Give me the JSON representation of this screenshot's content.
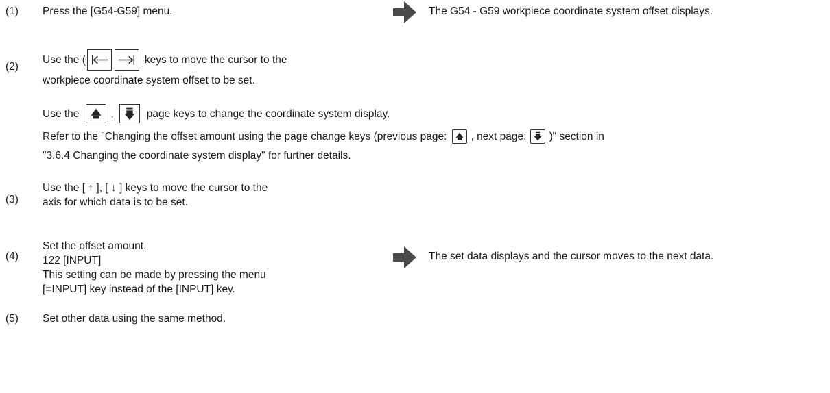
{
  "steps": [
    {
      "number": "(1)",
      "text": "Press the [G54-G59] menu.",
      "result": "The G54 - G59 workpiece coordinate system offset displays."
    },
    {
      "number": "(2)",
      "line1_prefix": "Use the (",
      "line1_suffix": "keys to move the cursor to the",
      "line2": "workpiece coordinate system offset to be set.",
      "page_keys_prefix": "Use the",
      "page_keys_comma": ",",
      "page_keys_suffix": "page keys to change the coordinate system display.",
      "refer_prefix": "Refer to the \"Changing the offset amount using the page change keys (previous page:",
      "refer_mid": ", next page:",
      "refer_suffix": ")\" section in",
      "refer_line2": "\"3.6.4 Changing the coordinate system display\" for further details."
    },
    {
      "number": "(3)",
      "line1": "Use the [ ↑ ], [ ↓ ] keys to move the cursor to the",
      "line2": "axis for which data is to be set."
    },
    {
      "number": "(4)",
      "line1": "Set the offset amount.",
      "line2": "122 [INPUT]",
      "line3": "This setting can be made by pressing the menu",
      "line4": "[=INPUT] key instead of the [INPUT] key.",
      "result": "The set data displays and the cursor moves to the next data."
    },
    {
      "number": "(5)",
      "text": "Set other data using the same method."
    }
  ],
  "icons": {
    "result_arrow": "right-arrow-icon",
    "left_key": "tab-left-key-icon",
    "right_key": "tab-right-key-icon",
    "page_up": "page-up-key-icon",
    "page_down": "page-down-key-icon"
  },
  "colors": {
    "arrow": "#4a4a4a",
    "text": "#1a1a1a"
  }
}
